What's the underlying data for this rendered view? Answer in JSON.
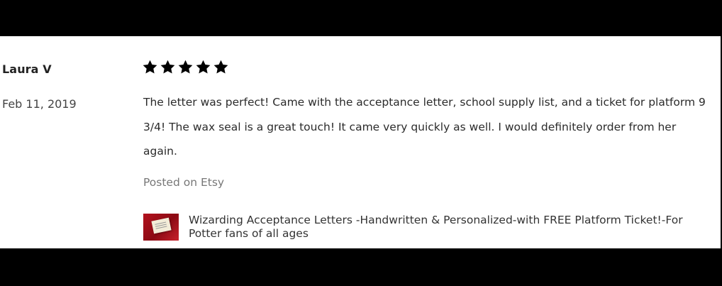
{
  "review": {
    "reviewer_name": "Laura V",
    "date": "Feb 11, 2019",
    "rating": 5,
    "rating_max": 5,
    "text": "The letter was perfect! Came with the acceptance letter, school supply list, and a ticket for platform 9 3/4! The wax seal is a great touch! It came very quickly as well. I would definitely order from her again.",
    "posted_on": "Posted on Etsy",
    "star_icon": "star-filled-icon",
    "star_color": "#000000"
  },
  "listing": {
    "title": "Wizarding Acceptance Letters -Handwritten & Personalized-with FREE Platform Ticket!-For Potter fans of all ages",
    "thumbnail_icon": "listing-thumbnail",
    "thumbnail_color": "#b3121d"
  }
}
